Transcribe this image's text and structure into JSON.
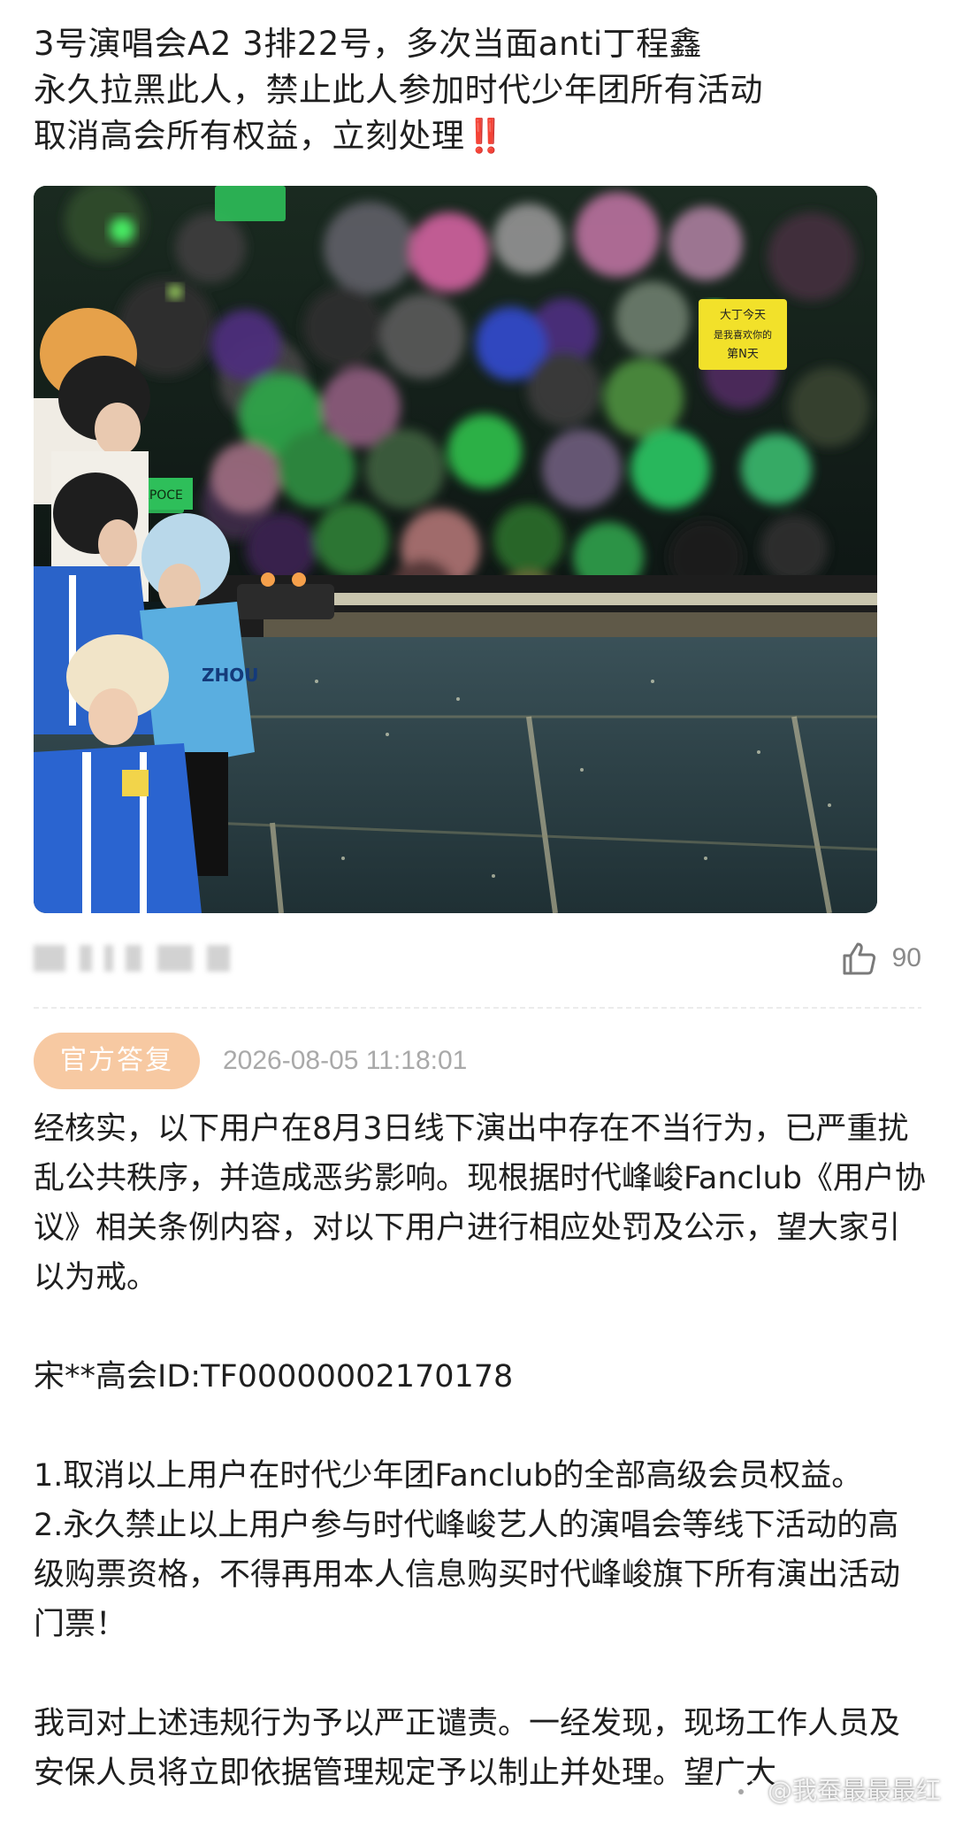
{
  "post": {
    "line1": "3号演唱会A2 3排22号，多次当面anti丁程鑫",
    "line2": "永久拉黑此人，禁止此人参加时代少年团所有活动",
    "line3": "取消高会所有权益，立刻处理",
    "emphasis": "‼️"
  },
  "photo": {
    "sign_text_1": "大丁今天",
    "sign_text_2": "是我喜欢你的",
    "sign_text_3": "第N天",
    "jersey_text": "ZHOU",
    "sign_left": "RPOCE"
  },
  "meta": {
    "like_count": "90",
    "like_icon": "thumbs-up-icon"
  },
  "reply": {
    "badge": "官方答复",
    "timestamp": "2026-08-05 11:18:01",
    "paragraphs": [
      "经核实，以下用户在8月3日线下演出中存在不当行为，已严重扰乱公共秩序，并造成恶劣影响。现根据时代峰峻Fanclub《用户协议》相关条例内容，对以下用户进行相应处罚及公示，望大家引以为戒。",
      "宋**高会ID:TF00000002170178",
      "1.取消以上用户在时代少年团Fanclub的全部高级会员权益。",
      "2.永久禁止以上用户参与时代峰峻艺人的演唱会等线下活动的高级购票资格，不得再用本人信息购买时代峰峻旗下所有演出活动门票！",
      "我司对上述违规行为予以严正谴责。一经发现，现场工作人员及安保人员将立即依据管理规定予以制止并处理。望广大"
    ]
  },
  "watermark": {
    "text": "@我蚕最最最红"
  },
  "colors": {
    "badge_bg": "#f7c9a2",
    "emphasis_red": "#e0241b",
    "muted_gray": "#a9a9a9"
  }
}
